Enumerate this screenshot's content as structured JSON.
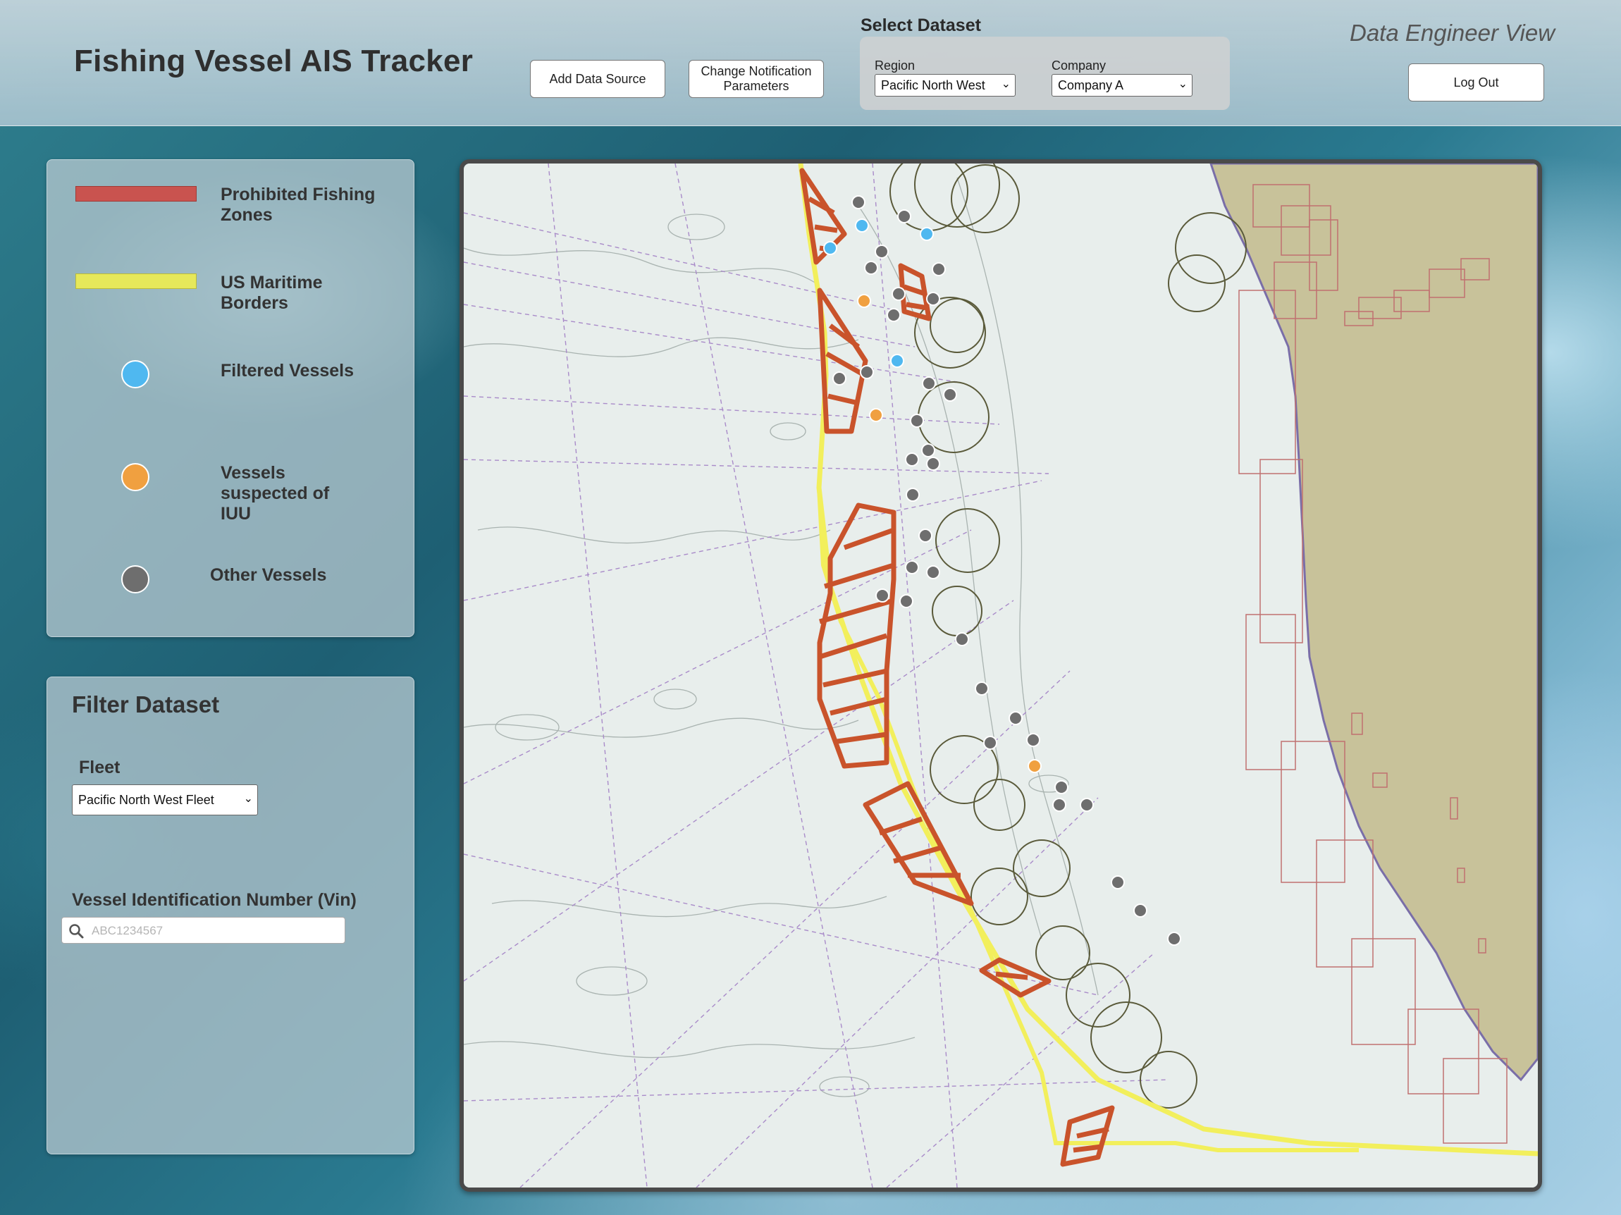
{
  "header": {
    "title": "Fishing Vessel AIS Tracker",
    "add_data_source": "Add Data Source",
    "change_notification": "Change Notification Parameters",
    "view_label": "Data Engineer View",
    "log_out": "Log Out"
  },
  "dataset": {
    "label": "Select Dataset",
    "region_label": "Region",
    "region_value": "Pacific North West",
    "company_label": "Company",
    "company_value": "Company A"
  },
  "legend": {
    "items": [
      {
        "label": "Prohibited Fishing Zones",
        "color": "#c9534f"
      },
      {
        "label": "US Maritime Borders",
        "color": "#e6e85a"
      },
      {
        "label": "Filtered Vessels",
        "color": "#4fb8f0"
      },
      {
        "label": "Vessels suspected of IUU",
        "color": "#f0a040"
      },
      {
        "label": "Other Vessels",
        "color": "#6e6e6e"
      }
    ]
  },
  "filter": {
    "title": "Filter Dataset",
    "fleet_label": "Fleet",
    "fleet_value": "Pacific North West Fleet",
    "vin_label": "Vessel Identification Number (Vin)",
    "vin_placeholder": "ABC1234567",
    "vin_value": ""
  },
  "map": {
    "colors": {
      "sea": "#e8eeec",
      "land": "#c8c29a",
      "zone": "#c9532b",
      "border": "#f2ef5c",
      "filtered": "#4fb8f0",
      "iuu": "#f0a040",
      "other": "#6e6e6e"
    }
  }
}
